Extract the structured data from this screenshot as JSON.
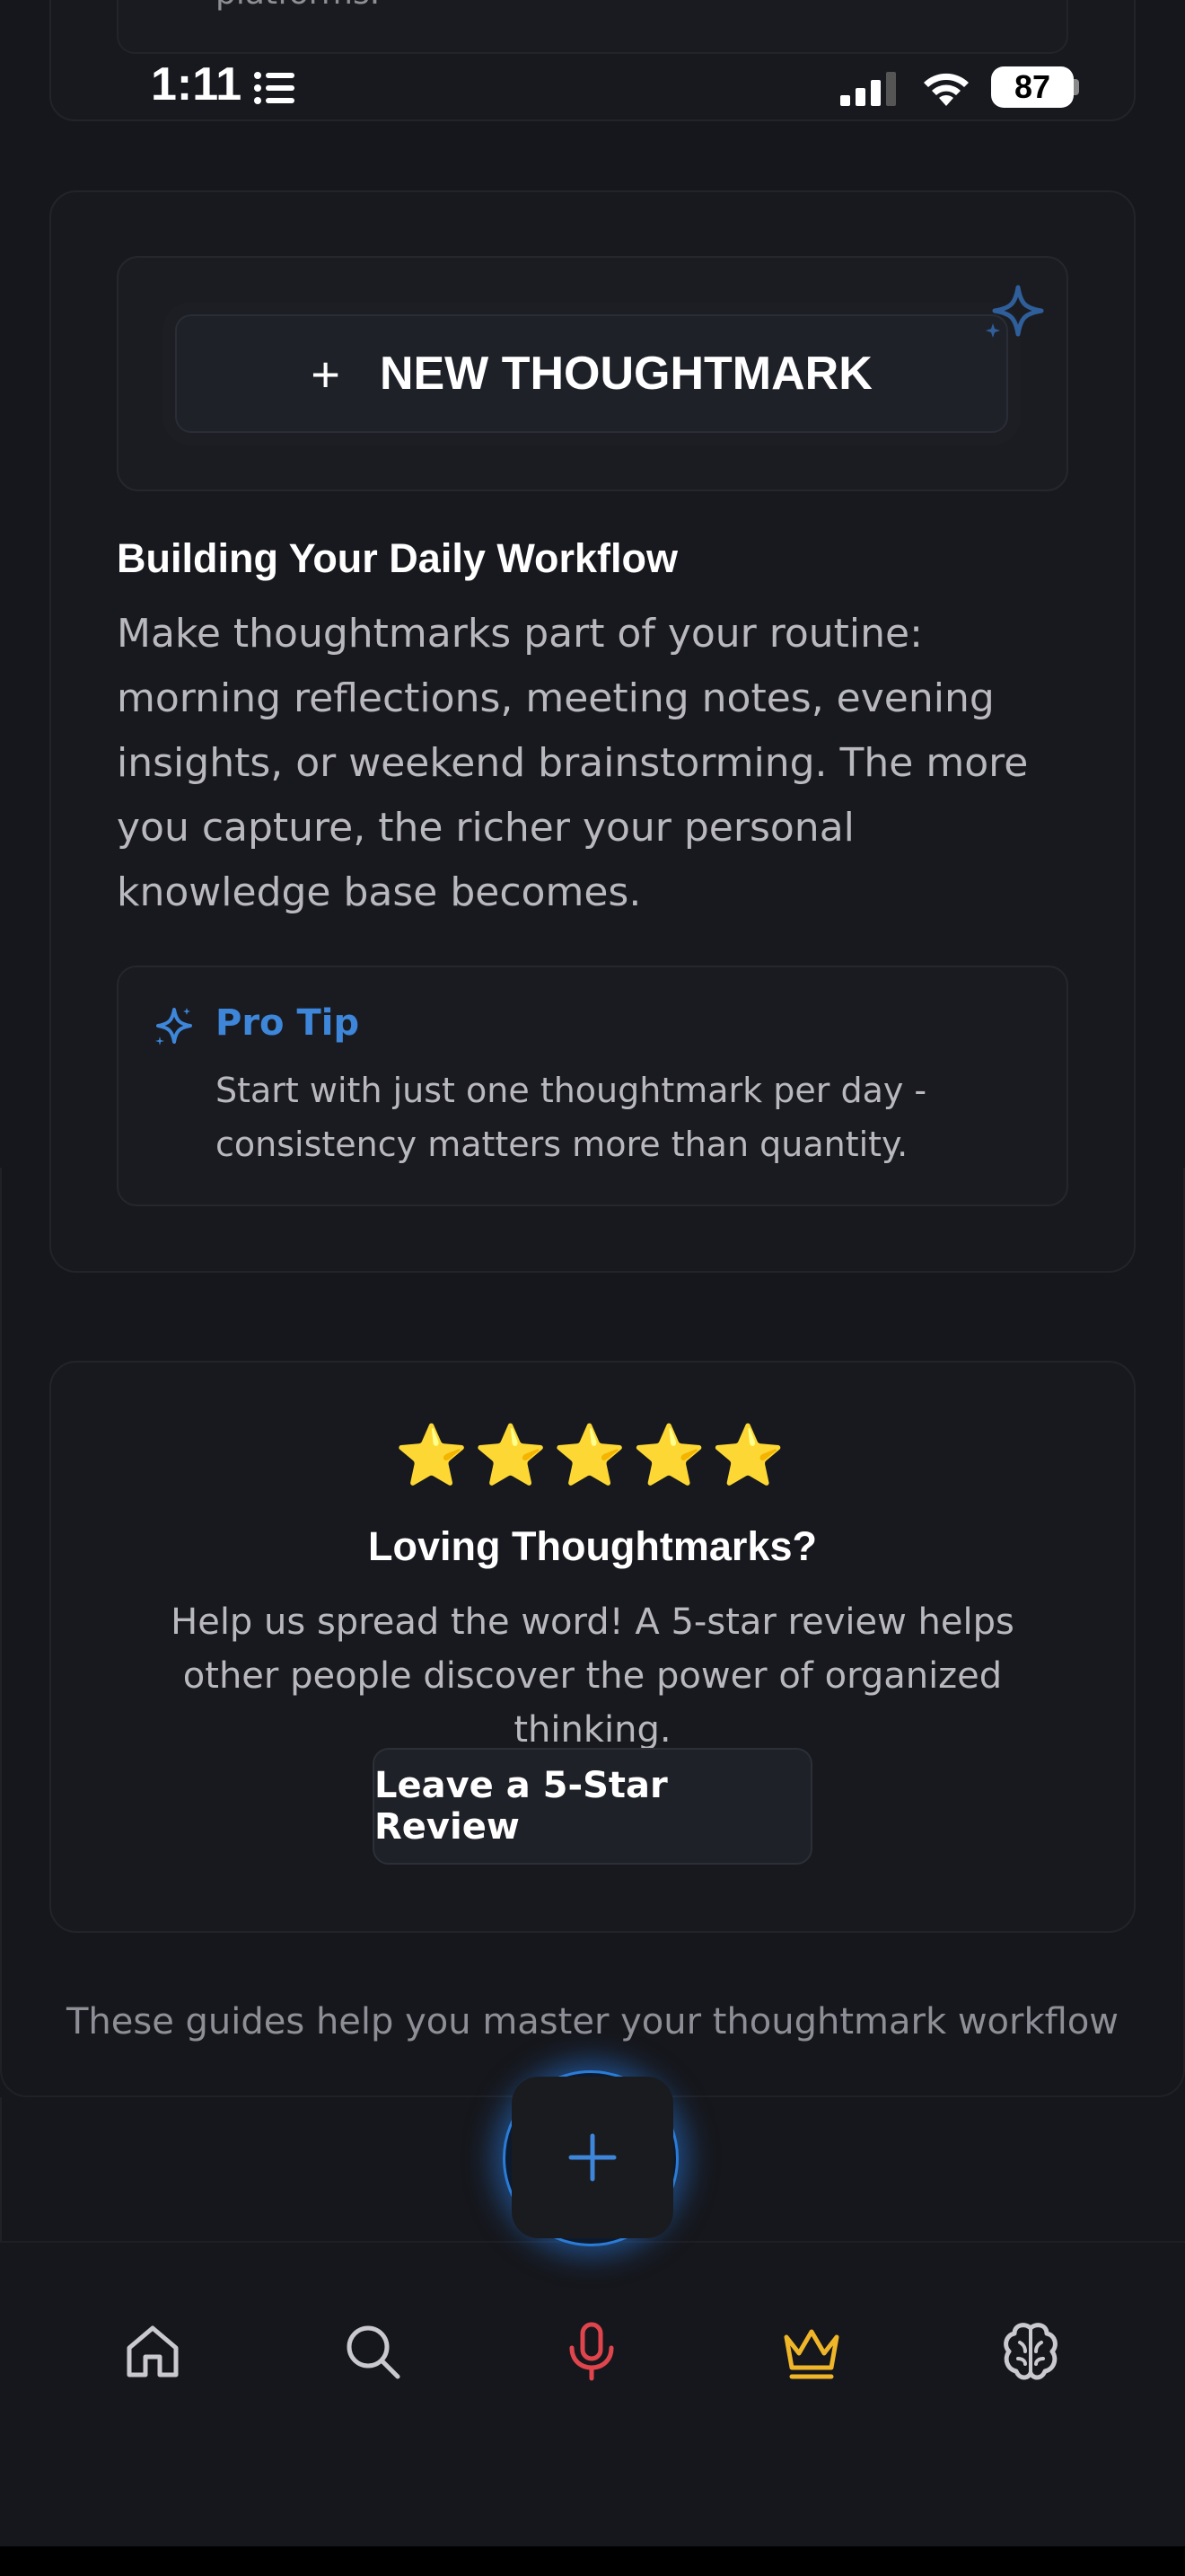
{
  "top_card": {
    "cut_text": "platforms."
  },
  "status_bar": {
    "time": "1:11",
    "battery": "87"
  },
  "new_thoughtmark": {
    "plus": "+",
    "label": "NEW THOUGHTMARK"
  },
  "workflow": {
    "title": "Building Your Daily Workflow",
    "body": "Make thoughtmarks part of your routine: morning reflections, meeting notes, evening insights, or weekend brainstorming. The more you capture, the richer your personal knowledge base becomes."
  },
  "pro_tip": {
    "title": "Pro Tip",
    "body": "Start with just one thoughtmark per day - consistency matters more than quantity."
  },
  "review": {
    "stars": "⭐⭐⭐⭐⭐",
    "title": "Loving Thoughtmarks?",
    "body": "Help us spread the word! A 5-star review helps other people discover the power of organized thinking.",
    "button": "Leave a 5-Star Review"
  },
  "footer_note": "These guides help you master your thoughtmark workflow",
  "colors": {
    "accent_blue": "#3d86d9",
    "mic_red": "#e0454d",
    "crown_gold": "#f0b62a",
    "star": "#ffc21a"
  },
  "tabs": [
    {
      "name": "home",
      "icon": "home-icon"
    },
    {
      "name": "search",
      "icon": "search-icon"
    },
    {
      "name": "voice",
      "icon": "microphone-icon"
    },
    {
      "name": "premium",
      "icon": "crown-icon"
    },
    {
      "name": "ai",
      "icon": "brain-icon"
    }
  ]
}
